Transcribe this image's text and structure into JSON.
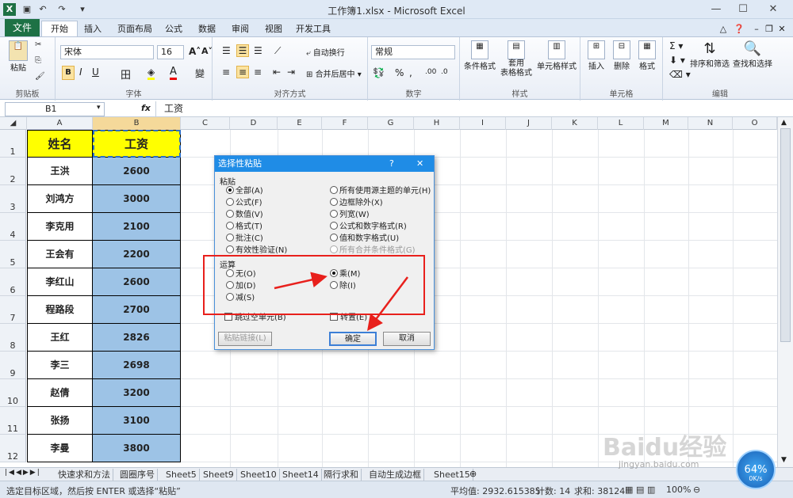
{
  "window": {
    "title": "工作簿1.xlsx - Microsoft Excel"
  },
  "tabs": [
    "文件",
    "开始",
    "插入",
    "页面布局",
    "公式",
    "数据",
    "审阅",
    "视图",
    "开发工具"
  ],
  "ribbon": {
    "groups": [
      "剪贴板",
      "字体",
      "对齐方式",
      "数字",
      "样式",
      "单元格",
      "编辑"
    ],
    "paste": "粘贴",
    "font_name": "宋体",
    "font_size": "16",
    "wrap_text": "自动换行",
    "merge_center": "合并后居中",
    "number_format": "常规",
    "cond_format": "条件格式",
    "table_format": "套用\n表格格式",
    "cell_style": "单元格样式",
    "insert": "插入",
    "delete": "删除",
    "format": "格式",
    "sort_filter": "排序和筛选",
    "find_select": "查找和选择"
  },
  "formula_bar": {
    "name_box": "B1",
    "fx": "fx",
    "content": "工资"
  },
  "columns": [
    "A",
    "B",
    "C",
    "D",
    "E",
    "F",
    "G",
    "H",
    "I",
    "J",
    "K",
    "L",
    "M",
    "N",
    "O"
  ],
  "table": {
    "headers": [
      "姓名",
      "工资"
    ],
    "rows": [
      [
        "王洪",
        "2600"
      ],
      [
        "刘鸿方",
        "3000"
      ],
      [
        "李克用",
        "2100"
      ],
      [
        "王会有",
        "2200"
      ],
      [
        "李红山",
        "2600"
      ],
      [
        "程路段",
        "2700"
      ],
      [
        "王红",
        "2826"
      ],
      [
        "李三",
        "2698"
      ],
      [
        "赵倩",
        "3200"
      ],
      [
        "张扬",
        "3100"
      ],
      [
        "李曼",
        "3800"
      ]
    ],
    "row_numbers": [
      "1",
      "2",
      "3",
      "4",
      "5",
      "6",
      "7",
      "8",
      "9",
      "10",
      "11",
      "12"
    ]
  },
  "dialog": {
    "title": "选择性粘贴",
    "help": "?",
    "close": "✕",
    "paste_section": "粘贴",
    "paste_left": [
      "全部(A)",
      "公式(F)",
      "数值(V)",
      "格式(T)",
      "批注(C)",
      "有效性验证(N)"
    ],
    "paste_right": [
      "所有使用源主题的单元(H)",
      "边框除外(X)",
      "列宽(W)",
      "公式和数字格式(R)",
      "值和数字格式(U)",
      "所有合并条件格式(G)"
    ],
    "op_section": "运算",
    "op_left": [
      "无(O)",
      "加(D)",
      "减(S)"
    ],
    "op_right": [
      "乘(M)",
      "除(I)"
    ],
    "skip_blanks": "跳过空单元(B)",
    "transpose": "转置(E)",
    "paste_link": "粘贴链接(L)",
    "ok": "确定",
    "cancel": "取消"
  },
  "sheet_tabs": [
    "快速求和方法",
    "圆圈序号",
    "Sheet5",
    "Sheet9",
    "Sheet10",
    "Sheet14",
    "隔行求和",
    "自动生成边框",
    "Sheet15"
  ],
  "status": {
    "message": "选定目标区域，然后按 ENTER 或选择“粘贴”",
    "average": "平均值: 2932.615385",
    "count": "计数: 14",
    "sum": "求和: 38124",
    "zoom": "100%"
  },
  "watermark": {
    "logo": "Baidu经验",
    "url": "jingyan.baidu.com"
  },
  "speed_widget": {
    "percent": "64%",
    "rate": "0K/s"
  },
  "colors": {
    "header_fill": "#ffff00",
    "salary_fill": "#9dc3e6",
    "file_tab": "#1e7145",
    "dialog_title": "#1f8ce6",
    "annotation": "#e8201c"
  }
}
